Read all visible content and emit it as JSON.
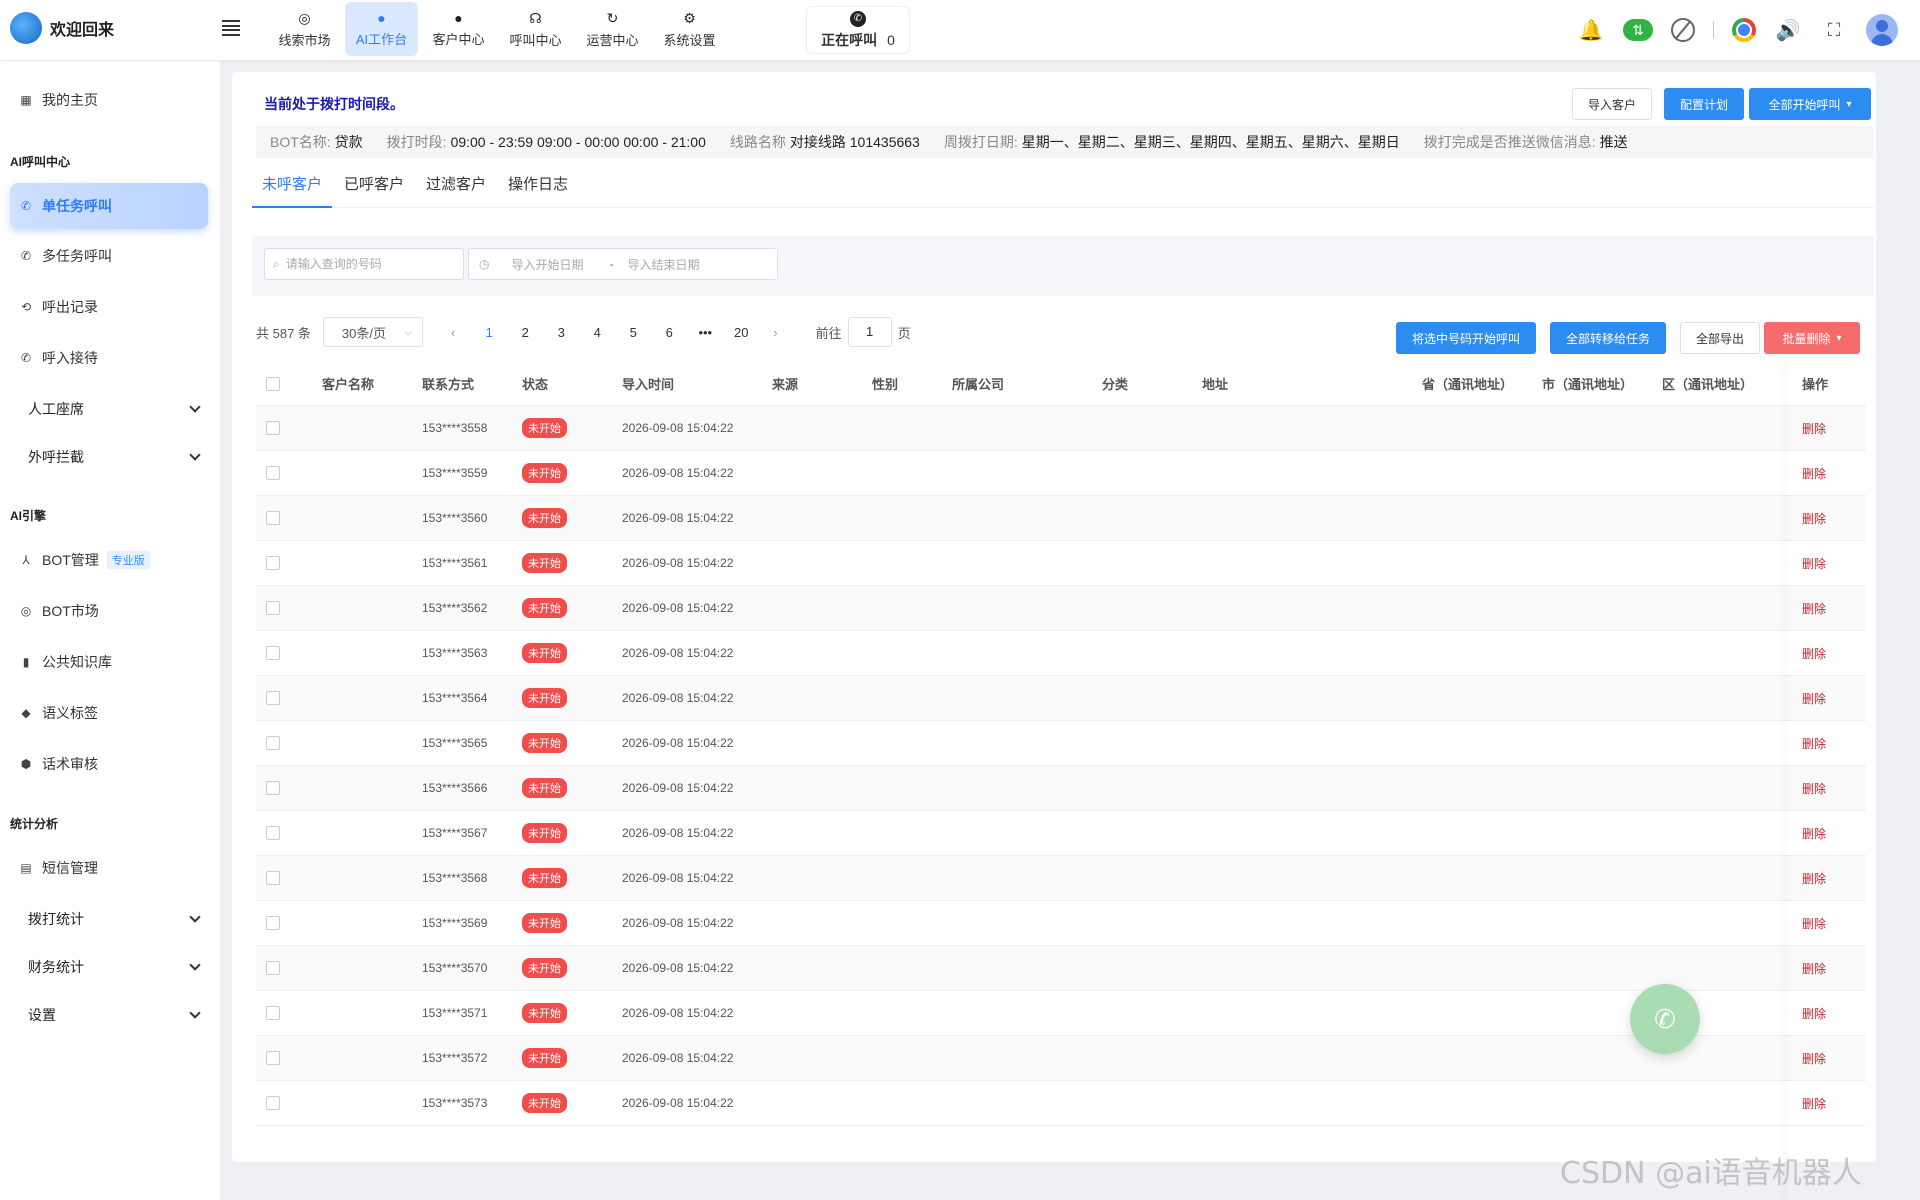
{
  "header": {
    "brand": "欢迎回来",
    "nav": [
      {
        "label": "线索市场",
        "icon": "target-icon"
      },
      {
        "label": "AI工作台",
        "icon": "robot-icon",
        "active": true
      },
      {
        "label": "客户中心",
        "icon": "users-icon"
      },
      {
        "label": "呼叫中心",
        "icon": "headset-icon"
      },
      {
        "label": "运营中心",
        "icon": "operation-icon"
      },
      {
        "label": "系统设置",
        "icon": "gear-icon"
      }
    ],
    "calling_label": "正在呼叫",
    "calling_count": "0"
  },
  "sidebar": {
    "home": "我的主页",
    "sec_ai_call": "AI呼叫中心",
    "single_task": "单任务呼叫",
    "multi_task": "多任务呼叫",
    "call_records": "呼出记录",
    "inbound": "呼入接待",
    "agent_seat": "人工座席",
    "outbound_block": "外呼拦截",
    "sec_ai_engine": "AI引擎",
    "bot_manage": "BOT管理",
    "pro_badge": "专业版",
    "bot_market": "BOT市场",
    "knowledge": "公共知识库",
    "semantic_tags": "语义标签",
    "script_review": "话术审核",
    "sec_stats": "统计分析",
    "sms": "短信管理",
    "dial_stats": "拨打统计",
    "finance_stats": "财务统计",
    "settings": "设置"
  },
  "main": {
    "notice": "当前处于拨打时间段。",
    "btn_import": "导入客户",
    "btn_config": "配置计划",
    "btn_start_all": "全部开始呼叫",
    "info": {
      "bot_label": "BOT名称:",
      "bot_value": "贷款",
      "period_label": "拨打时段:",
      "period_value": "09:00 - 23:59 09:00 - 00:00 00:00 - 21:00",
      "line_label": "线路名称",
      "line_value": "对接线路 101435663",
      "week_label": "周拨打日期:",
      "week_value": "星期一、星期二、星期三、星期四、星期五、星期六、星期日",
      "wechat_label": "拨打完成是否推送微信消息:",
      "wechat_value": "推送"
    },
    "tabs": [
      "未呼客户",
      "已呼客户",
      "过滤客户",
      "操作日志"
    ],
    "search_placeholder": "请输入查询的号码",
    "date_start": "导入开始日期",
    "date_sep": "-",
    "date_end": "导入结束日期",
    "pager": {
      "total": "共 587 条",
      "size": "30条/页",
      "pages": [
        "1",
        "2",
        "3",
        "4",
        "5",
        "6",
        "•••",
        "20"
      ],
      "goto_label": "前往",
      "goto_value": "1",
      "page_unit": "页"
    },
    "actions": {
      "call_selected": "将选中号码开始呼叫",
      "transfer_all": "全部转移给任务",
      "export_all": "全部导出",
      "batch_delete": "批量删除"
    },
    "columns": [
      "客户名称",
      "联系方式",
      "状态",
      "导入时间",
      "来源",
      "性别",
      "所属公司",
      "分类",
      "地址",
      "省（通讯地址）",
      "市（通讯地址）",
      "区（通讯地址）",
      "操作"
    ],
    "rows": [
      {
        "phone": "153****3558",
        "status": "未开始",
        "time": "2026-09-08 15:04:22",
        "op": "删除"
      },
      {
        "phone": "153****3559",
        "status": "未开始",
        "time": "2026-09-08 15:04:22",
        "op": "删除"
      },
      {
        "phone": "153****3560",
        "status": "未开始",
        "time": "2026-09-08 15:04:22",
        "op": "删除"
      },
      {
        "phone": "153****3561",
        "status": "未开始",
        "time": "2026-09-08 15:04:22",
        "op": "删除"
      },
      {
        "phone": "153****3562",
        "status": "未开始",
        "time": "2026-09-08 15:04:22",
        "op": "删除"
      },
      {
        "phone": "153****3563",
        "status": "未开始",
        "time": "2026-09-08 15:04:22",
        "op": "删除"
      },
      {
        "phone": "153****3564",
        "status": "未开始",
        "time": "2026-09-08 15:04:22",
        "op": "删除"
      },
      {
        "phone": "153****3565",
        "status": "未开始",
        "time": "2026-09-08 15:04:22",
        "op": "删除"
      },
      {
        "phone": "153****3566",
        "status": "未开始",
        "time": "2026-09-08 15:04:22",
        "op": "删除"
      },
      {
        "phone": "153****3567",
        "status": "未开始",
        "time": "2026-09-08 15:04:22",
        "op": "删除"
      },
      {
        "phone": "153****3568",
        "status": "未开始",
        "time": "2026-09-08 15:04:22",
        "op": "删除"
      },
      {
        "phone": "153****3569",
        "status": "未开始",
        "time": "2026-09-08 15:04:22",
        "op": "删除"
      },
      {
        "phone": "153****3570",
        "status": "未开始",
        "time": "2026-09-08 15:04:22",
        "op": "删除"
      },
      {
        "phone": "153****3571",
        "status": "未开始",
        "time": "2026-09-08 15:04:22",
        "op": "删除"
      },
      {
        "phone": "153****3572",
        "status": "未开始",
        "time": "2026-09-08 15:04:22",
        "op": "删除"
      },
      {
        "phone": "153****3573",
        "status": "未开始",
        "time": "2026-09-08 15:04:22",
        "op": "删除"
      }
    ]
  },
  "watermark": "CSDN @ai语音机器人"
}
